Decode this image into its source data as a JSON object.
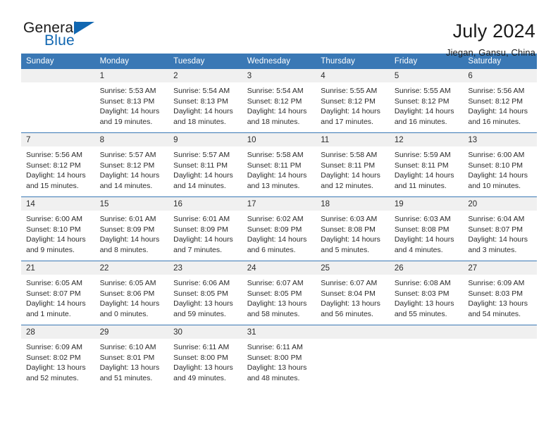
{
  "brand": {
    "word_one": "General",
    "word_two": "Blue",
    "logo_icon": "triangle-icon"
  },
  "header": {
    "title": "July 2024",
    "subtitle": "Jiegan, Gansu, China"
  },
  "calendar": {
    "accent_color": "#3a78b5",
    "band_color": "#f0f0f0",
    "day_headers": [
      "Sunday",
      "Monday",
      "Tuesday",
      "Wednesday",
      "Thursday",
      "Friday",
      "Saturday"
    ],
    "weeks": [
      [
        {
          "day": "",
          "lines": []
        },
        {
          "day": "1",
          "lines": [
            "Sunrise: 5:53 AM",
            "Sunset: 8:13 PM",
            "Daylight: 14 hours",
            "and 19 minutes."
          ]
        },
        {
          "day": "2",
          "lines": [
            "Sunrise: 5:54 AM",
            "Sunset: 8:13 PM",
            "Daylight: 14 hours",
            "and 18 minutes."
          ]
        },
        {
          "day": "3",
          "lines": [
            "Sunrise: 5:54 AM",
            "Sunset: 8:12 PM",
            "Daylight: 14 hours",
            "and 18 minutes."
          ]
        },
        {
          "day": "4",
          "lines": [
            "Sunrise: 5:55 AM",
            "Sunset: 8:12 PM",
            "Daylight: 14 hours",
            "and 17 minutes."
          ]
        },
        {
          "day": "5",
          "lines": [
            "Sunrise: 5:55 AM",
            "Sunset: 8:12 PM",
            "Daylight: 14 hours",
            "and 16 minutes."
          ]
        },
        {
          "day": "6",
          "lines": [
            "Sunrise: 5:56 AM",
            "Sunset: 8:12 PM",
            "Daylight: 14 hours",
            "and 16 minutes."
          ]
        }
      ],
      [
        {
          "day": "7",
          "lines": [
            "Sunrise: 5:56 AM",
            "Sunset: 8:12 PM",
            "Daylight: 14 hours",
            "and 15 minutes."
          ]
        },
        {
          "day": "8",
          "lines": [
            "Sunrise: 5:57 AM",
            "Sunset: 8:12 PM",
            "Daylight: 14 hours",
            "and 14 minutes."
          ]
        },
        {
          "day": "9",
          "lines": [
            "Sunrise: 5:57 AM",
            "Sunset: 8:11 PM",
            "Daylight: 14 hours",
            "and 14 minutes."
          ]
        },
        {
          "day": "10",
          "lines": [
            "Sunrise: 5:58 AM",
            "Sunset: 8:11 PM",
            "Daylight: 14 hours",
            "and 13 minutes."
          ]
        },
        {
          "day": "11",
          "lines": [
            "Sunrise: 5:58 AM",
            "Sunset: 8:11 PM",
            "Daylight: 14 hours",
            "and 12 minutes."
          ]
        },
        {
          "day": "12",
          "lines": [
            "Sunrise: 5:59 AM",
            "Sunset: 8:11 PM",
            "Daylight: 14 hours",
            "and 11 minutes."
          ]
        },
        {
          "day": "13",
          "lines": [
            "Sunrise: 6:00 AM",
            "Sunset: 8:10 PM",
            "Daylight: 14 hours",
            "and 10 minutes."
          ]
        }
      ],
      [
        {
          "day": "14",
          "lines": [
            "Sunrise: 6:00 AM",
            "Sunset: 8:10 PM",
            "Daylight: 14 hours",
            "and 9 minutes."
          ]
        },
        {
          "day": "15",
          "lines": [
            "Sunrise: 6:01 AM",
            "Sunset: 8:09 PM",
            "Daylight: 14 hours",
            "and 8 minutes."
          ]
        },
        {
          "day": "16",
          "lines": [
            "Sunrise: 6:01 AM",
            "Sunset: 8:09 PM",
            "Daylight: 14 hours",
            "and 7 minutes."
          ]
        },
        {
          "day": "17",
          "lines": [
            "Sunrise: 6:02 AM",
            "Sunset: 8:09 PM",
            "Daylight: 14 hours",
            "and 6 minutes."
          ]
        },
        {
          "day": "18",
          "lines": [
            "Sunrise: 6:03 AM",
            "Sunset: 8:08 PM",
            "Daylight: 14 hours",
            "and 5 minutes."
          ]
        },
        {
          "day": "19",
          "lines": [
            "Sunrise: 6:03 AM",
            "Sunset: 8:08 PM",
            "Daylight: 14 hours",
            "and 4 minutes."
          ]
        },
        {
          "day": "20",
          "lines": [
            "Sunrise: 6:04 AM",
            "Sunset: 8:07 PM",
            "Daylight: 14 hours",
            "and 3 minutes."
          ]
        }
      ],
      [
        {
          "day": "21",
          "lines": [
            "Sunrise: 6:05 AM",
            "Sunset: 8:07 PM",
            "Daylight: 14 hours",
            "and 1 minute."
          ]
        },
        {
          "day": "22",
          "lines": [
            "Sunrise: 6:05 AM",
            "Sunset: 8:06 PM",
            "Daylight: 14 hours",
            "and 0 minutes."
          ]
        },
        {
          "day": "23",
          "lines": [
            "Sunrise: 6:06 AM",
            "Sunset: 8:05 PM",
            "Daylight: 13 hours",
            "and 59 minutes."
          ]
        },
        {
          "day": "24",
          "lines": [
            "Sunrise: 6:07 AM",
            "Sunset: 8:05 PM",
            "Daylight: 13 hours",
            "and 58 minutes."
          ]
        },
        {
          "day": "25",
          "lines": [
            "Sunrise: 6:07 AM",
            "Sunset: 8:04 PM",
            "Daylight: 13 hours",
            "and 56 minutes."
          ]
        },
        {
          "day": "26",
          "lines": [
            "Sunrise: 6:08 AM",
            "Sunset: 8:03 PM",
            "Daylight: 13 hours",
            "and 55 minutes."
          ]
        },
        {
          "day": "27",
          "lines": [
            "Sunrise: 6:09 AM",
            "Sunset: 8:03 PM",
            "Daylight: 13 hours",
            "and 54 minutes."
          ]
        }
      ],
      [
        {
          "day": "28",
          "lines": [
            "Sunrise: 6:09 AM",
            "Sunset: 8:02 PM",
            "Daylight: 13 hours",
            "and 52 minutes."
          ]
        },
        {
          "day": "29",
          "lines": [
            "Sunrise: 6:10 AM",
            "Sunset: 8:01 PM",
            "Daylight: 13 hours",
            "and 51 minutes."
          ]
        },
        {
          "day": "30",
          "lines": [
            "Sunrise: 6:11 AM",
            "Sunset: 8:00 PM",
            "Daylight: 13 hours",
            "and 49 minutes."
          ]
        },
        {
          "day": "31",
          "lines": [
            "Sunrise: 6:11 AM",
            "Sunset: 8:00 PM",
            "Daylight: 13 hours",
            "and 48 minutes."
          ]
        },
        {
          "day": "",
          "lines": []
        },
        {
          "day": "",
          "lines": []
        },
        {
          "day": "",
          "lines": []
        }
      ]
    ]
  }
}
